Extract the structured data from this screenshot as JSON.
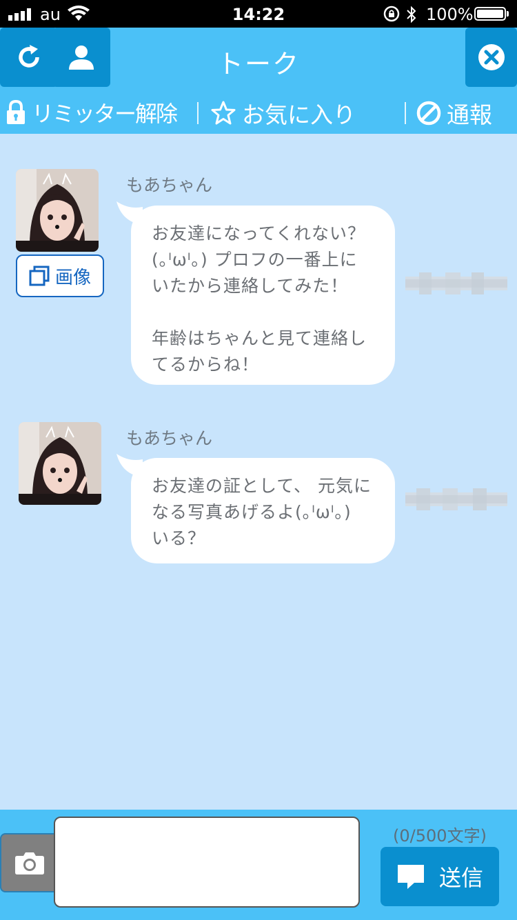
{
  "status_bar": {
    "carrier": "au",
    "time": "14:22",
    "battery": "100%"
  },
  "header": {
    "title": "トーク"
  },
  "actions": {
    "limiter": "リミッター解除",
    "favorite": "お気に入り",
    "report": "通報"
  },
  "messages": [
    {
      "sender": "もあちゃん",
      "text": "お友達になってくれない？\n(｡ᴵωᴵ｡) プロフの一番上に\nいたから連絡してみた！\n\n年齢はちゃんと見て連絡し\nてるからね！",
      "image_button": "画像"
    },
    {
      "sender": "もあちゃん",
      "text": "お友達の証として、 元気に\nなる写真あげるよ(｡ᴵωᴵ｡)\nいる？"
    }
  ],
  "footer": {
    "char_count": "(0/500文字)",
    "send_label": "送信",
    "input_value": ""
  },
  "colors": {
    "header": "#4bc1f7",
    "button": "#0a8fcf",
    "chat_bg": "#c8e4fc"
  }
}
